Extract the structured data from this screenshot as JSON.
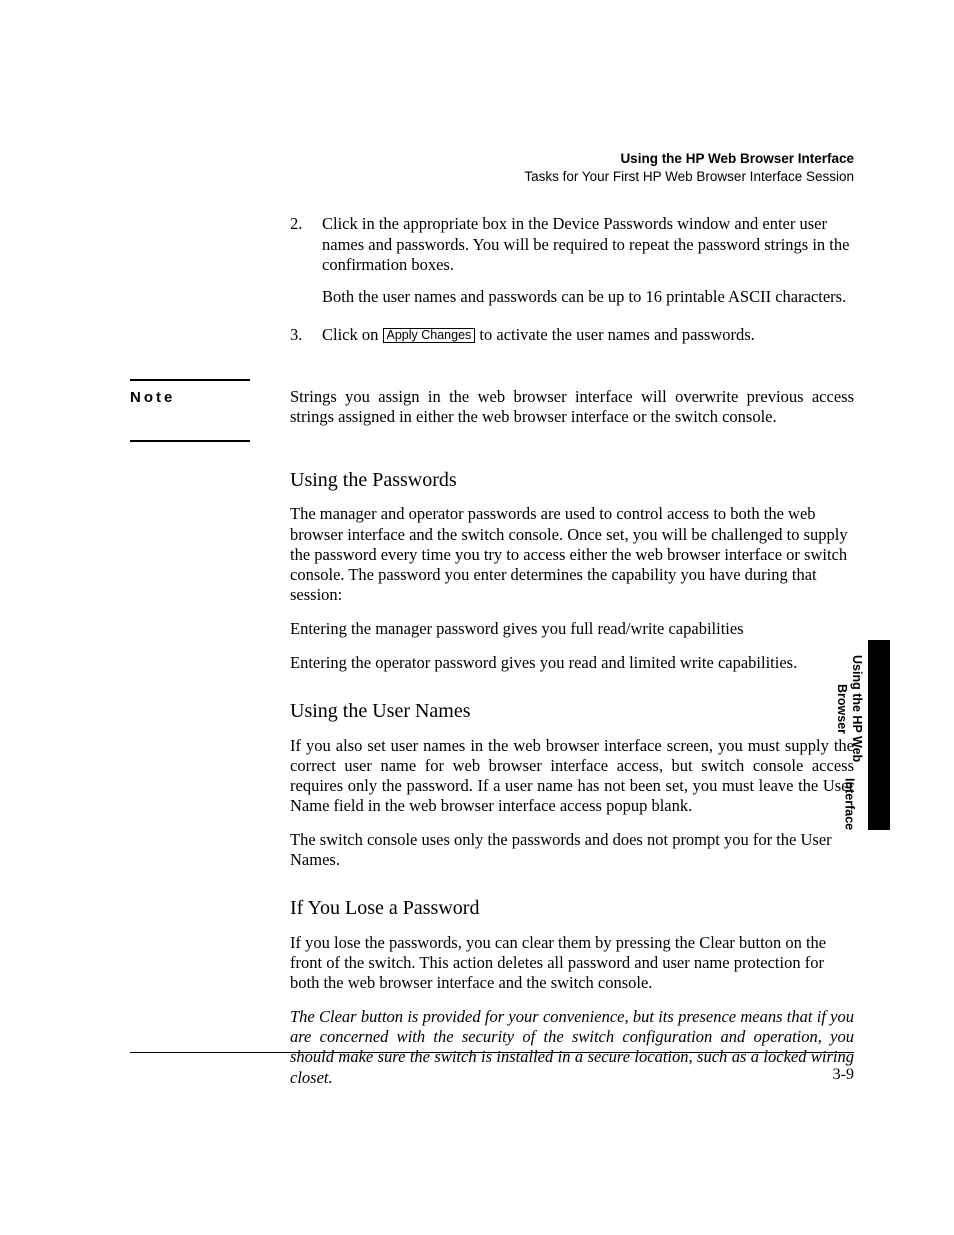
{
  "header": {
    "title": "Using the HP Web Browser Interface",
    "subtitle": "Tasks for Your First HP Web Browser Interface Session"
  },
  "steps": [
    {
      "num": "2.",
      "p1": "Click in the appropriate box in the Device Passwords window and enter user names and passwords. You will be required to repeat the password strings in the confirmation boxes.",
      "p2": "Both the user names and passwords can be up to 16 printable ASCII characters."
    },
    {
      "num": "3.",
      "pre": "Click on ",
      "button": "Apply Changes",
      "post": " to activate the user names and passwords."
    }
  ],
  "note": {
    "label": "Note",
    "body": "Strings you assign in the web browser interface will overwrite previous access strings assigned in either the web browser interface or the switch console."
  },
  "sections": {
    "passwords": {
      "heading": "Using the Passwords",
      "p1": "The manager and operator passwords are used to control access to both the web browser interface and the switch console. Once set, you will be challenged to supply the password every time you try to access either the web browser interface or switch console. The password you enter determines the capability you have during that session:",
      "b1": "Entering the manager password gives you full read/write capabilities",
      "b2": "Entering the operator password gives you read and limited write capabilities."
    },
    "usernames": {
      "heading": "Using the User Names",
      "p1": "If you also set user names in the web browser interface screen, you must supply the correct user name for web browser interface access, but switch console access requires only the password. If a user name has not been set, you must leave the User Name field in the web browser interface access popup blank.",
      "p2": "The switch console uses only the passwords and does not prompt you for the User Names."
    },
    "lose": {
      "heading": "If You Lose a Password",
      "p1": "If you lose the passwords, you can clear them by pressing the Clear button on the front of the switch. This action deletes all password and user name protection for both the web browser interface and the switch console.",
      "p2": "The Clear button is provided for your convenience, but its presence means that if you are concerned with the security of the switch configuration and operation, you should make sure the switch is installed in a secure location, such as a locked wiring closet."
    }
  },
  "sideTab": {
    "line1": "Using the HP Web Browser",
    "line2": "Interface"
  },
  "pageNumber": "3-9"
}
